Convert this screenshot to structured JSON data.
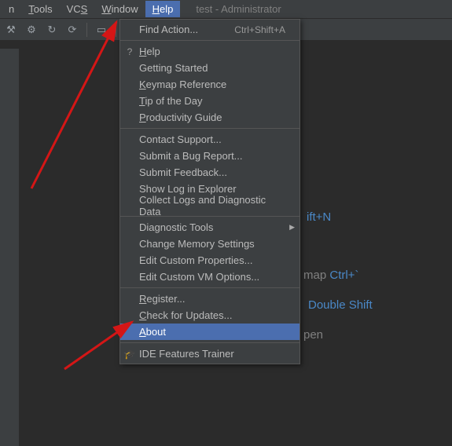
{
  "menubar": {
    "items": [
      {
        "label": "n",
        "full": "Run",
        "type": "partial"
      },
      {
        "label": "Tools",
        "mn": "T"
      },
      {
        "label": "VCS",
        "mn": "S",
        "pre": "VC"
      },
      {
        "label": "Window",
        "mn": "W"
      },
      {
        "label": "Help",
        "mn": "H",
        "active": true
      }
    ],
    "title": "test - Administrator"
  },
  "toolbar": {
    "icons": [
      "hammer-icon",
      "gear-icon",
      "arrows-icon",
      "refresh-icon",
      "sep",
      "box-icon",
      "sep",
      "wrench-icon"
    ]
  },
  "dropdown": {
    "items": [
      {
        "label": "Find Action...",
        "shortcut": "Ctrl+Shift+A"
      },
      {
        "sep": true
      },
      {
        "label": "Help",
        "mn": "H",
        "icon": "?"
      },
      {
        "label": "Getting Started"
      },
      {
        "label": "Keymap Reference",
        "mn": "K"
      },
      {
        "label": "Tip of the Day",
        "mn": "T"
      },
      {
        "label": "Productivity Guide",
        "mn": "P"
      },
      {
        "sep": true
      },
      {
        "label": "Contact Support..."
      },
      {
        "label": "Submit a Bug Report..."
      },
      {
        "label": "Submit Feedback..."
      },
      {
        "label": "Show Log in Explorer"
      },
      {
        "label": "Collect Logs and Diagnostic Data"
      },
      {
        "sep": true
      },
      {
        "label": "Diagnostic Tools",
        "submenu": true
      },
      {
        "label": "Change Memory Settings"
      },
      {
        "label": "Edit Custom Properties..."
      },
      {
        "label": "Edit Custom VM Options..."
      },
      {
        "sep": true
      },
      {
        "label": "Register...",
        "mn": "R"
      },
      {
        "label": "Check for Updates...",
        "mn": "C"
      },
      {
        "label": "About",
        "mn": "A",
        "selected": true
      },
      {
        "sep": true
      },
      {
        "label": "IDE Features Trainer",
        "icon": "🎓"
      }
    ]
  },
  "hints": {
    "h1_key": "ift+N",
    "h2_text": "map ",
    "h2_key": "Ctrl+`",
    "h3_key": "Double Shift",
    "h4_text": "pen"
  }
}
